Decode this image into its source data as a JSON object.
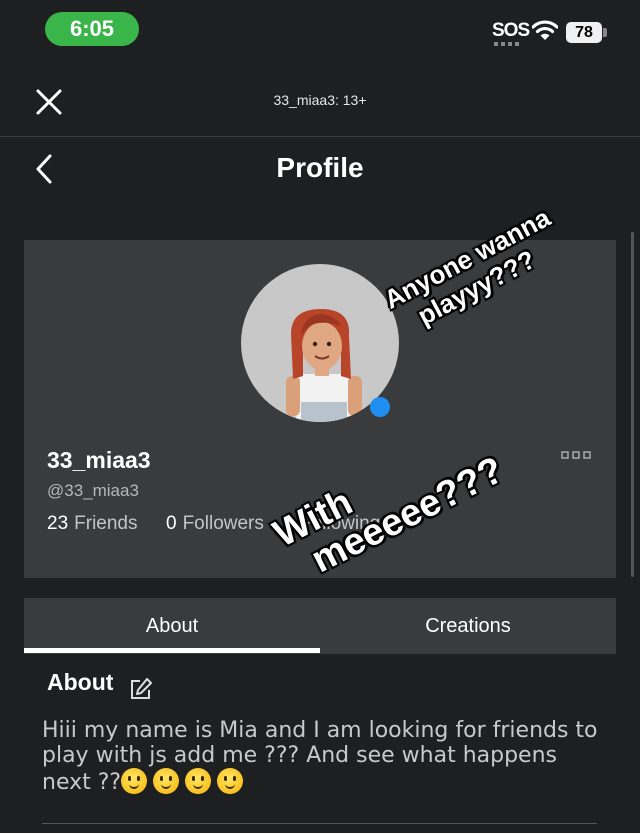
{
  "status_bar": {
    "time": "6:05",
    "sos": "SOS",
    "battery": "78",
    "accent_color": "#39b54a"
  },
  "header": {
    "close_icon": "close-icon",
    "title": "33_miaa3: 13+"
  },
  "nav": {
    "back_icon": "chevron-left-icon",
    "title": "Profile"
  },
  "profile": {
    "username": "33_miaa3",
    "handle": "@33_miaa3",
    "online_status_color": "#1f8ef1",
    "stats": {
      "friends_count": "23",
      "friends_label": "Friends",
      "followers_count": "0",
      "followers_label": "Followers",
      "following_label": "Following"
    },
    "more_icon": "more-horizontal-icon"
  },
  "stickers": {
    "first_line1": "Anyone wanna",
    "first_line2": "playyy???",
    "second_line1": "With",
    "second_line2": "meeeee???"
  },
  "tabs": [
    {
      "label": "About",
      "active": true
    },
    {
      "label": "Creations",
      "active": false
    }
  ],
  "about": {
    "heading": "About",
    "edit_icon": "edit-icon",
    "text": "Hiii my name is Mia and I am looking for friends to play with js add me ??? And see what happens next ??"
  }
}
